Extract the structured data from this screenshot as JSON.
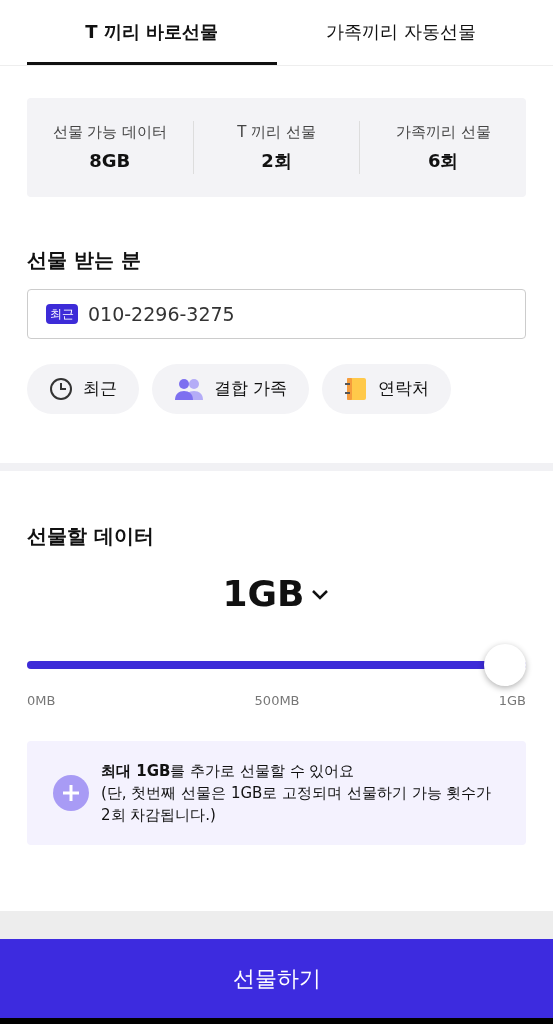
{
  "tabs": [
    {
      "label": "T 끼리 바로선물",
      "selected": true
    },
    {
      "label": "가족끼리 자동선물",
      "selected": false
    }
  ],
  "stats": [
    {
      "label": "선물 가능 데이터",
      "value": "8GB"
    },
    {
      "label": "T 끼리 선물",
      "value": "2회"
    },
    {
      "label": "가족끼리 선물",
      "value": "6회"
    }
  ],
  "recipient": {
    "title": "선물 받는 분",
    "badge": "최근",
    "value": "010-2296-3275"
  },
  "quick_buttons": [
    {
      "kind": "clock",
      "label": "최근"
    },
    {
      "kind": "people",
      "label": "결합 가족"
    },
    {
      "kind": "book",
      "label": "연락처"
    }
  ],
  "data_section": {
    "title": "선물할 데이터",
    "amount": "1GB",
    "slider": {
      "level": 1.0,
      "ticks": [
        "0MB",
        "500MB",
        "1GB"
      ]
    }
  },
  "info": {
    "line1": "**최대 1GB**를 추가로 선물할 수 있어요",
    "line2": "(단, 첫번째 선물은 1GB로 고정되며 선물하기 가능 횟수가 2회 차감됩니다.)"
  },
  "submit": "선물하기"
}
